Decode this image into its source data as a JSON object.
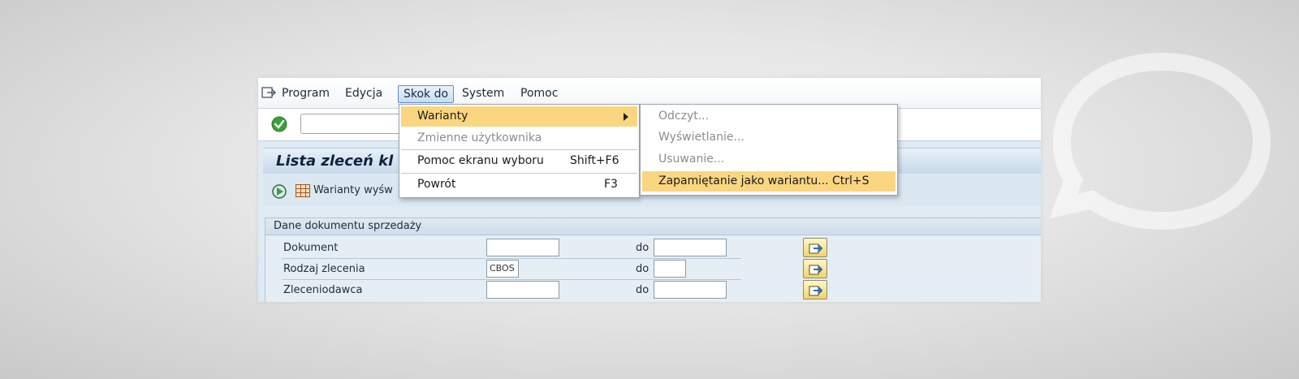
{
  "menubar": {
    "items": [
      {
        "label": "Program"
      },
      {
        "label": "Edycja"
      },
      {
        "label": "Skok do"
      },
      {
        "label": "System"
      },
      {
        "label": "Pomoc"
      }
    ]
  },
  "screen": {
    "title": "Lista zleceń kl",
    "toolbar_label": "Warianty wyśw"
  },
  "selection_group": {
    "title": "Dane dokumentu sprzedaży",
    "range_label": "do",
    "rows": [
      {
        "label": "Dokument",
        "from": "",
        "to": ""
      },
      {
        "label": "Rodzaj zlecenia",
        "from": "CBOS",
        "to": ""
      },
      {
        "label": "Zleceniodawca",
        "from": "",
        "to": ""
      }
    ]
  },
  "skok_do_menu": {
    "items": [
      {
        "label": "Warianty",
        "shortcut": "",
        "state": "highlighted",
        "has_submenu": true
      },
      {
        "label": "Zmienne użytkownika",
        "shortcut": "",
        "state": "disabled"
      },
      {
        "label": "Pomoc ekranu wyboru",
        "shortcut": "Shift+F6",
        "state": "enabled"
      },
      {
        "label": "Powrót",
        "shortcut": "F3",
        "state": "enabled"
      }
    ]
  },
  "warianty_submenu": {
    "items": [
      {
        "label": "Odczyt...",
        "shortcut": "",
        "state": "disabled"
      },
      {
        "label": "Wyświetlanie...",
        "shortcut": "",
        "state": "disabled"
      },
      {
        "label": "Usuwanie...",
        "shortcut": "",
        "state": "disabled"
      },
      {
        "label": "Zapamiętanie jako wariantu...",
        "shortcut": "Ctrl+S",
        "state": "highlighted"
      }
    ]
  },
  "colors": {
    "menu_highlight": "#fbd680",
    "title_text": "#0c2340",
    "panel_bg": "#dfeaf3"
  },
  "icons": [
    "exit-icon",
    "checkmark-icon",
    "execute-icon",
    "grid-icon",
    "multiple-selection-icon",
    "submenu-arrow-icon",
    "speech-bubble-icon"
  ]
}
